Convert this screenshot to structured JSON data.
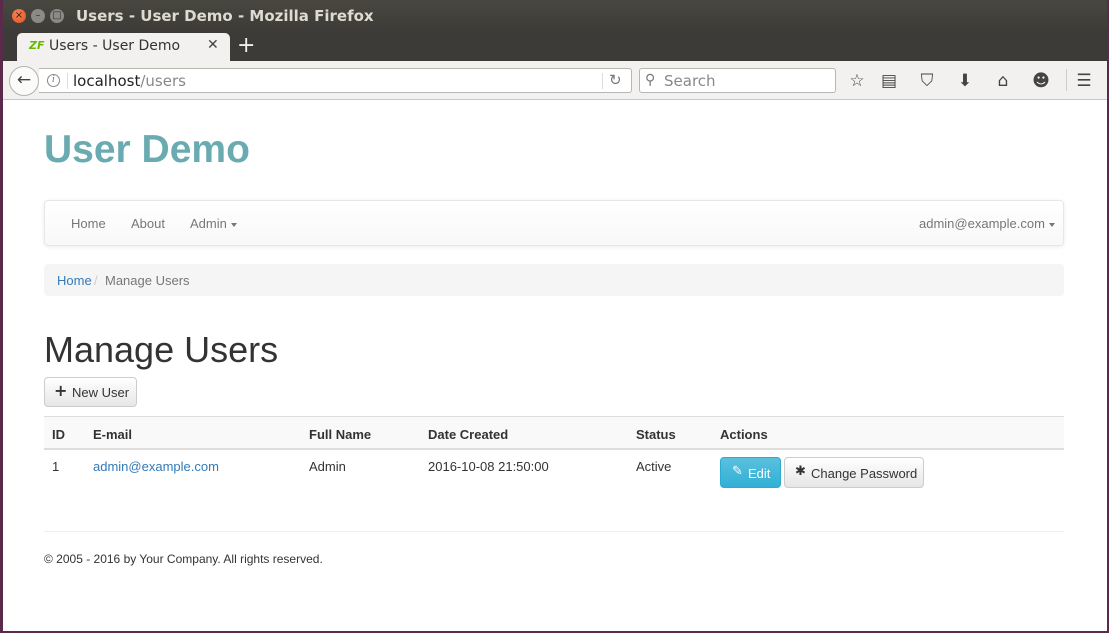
{
  "window": {
    "title": "Users - User Demo - Mozilla Firefox",
    "close_glyph": "×",
    "minimize_glyph": "–",
    "maximize_glyph": "□"
  },
  "tab": {
    "favicon_text": "ZF",
    "title": "Users - User Demo",
    "close_glyph": "✕",
    "new_tab_glyph": "+"
  },
  "toolbar": {
    "back_glyph": "←",
    "info_glyph": "i",
    "url_host": "localhost",
    "url_path": "/users",
    "reload_glyph": "↻",
    "search_glyph": "⚲",
    "search_placeholder": "Search",
    "icons": {
      "bookmark_star": "☆",
      "reading_list": "▤",
      "pocket": "⛉",
      "downloads": "⬇",
      "home": "⌂",
      "hello": "☻",
      "menu": "☰"
    }
  },
  "page": {
    "brand": "User Demo",
    "nav": {
      "items": [
        "Home",
        "About",
        "Admin"
      ],
      "user": "admin@example.com"
    },
    "breadcrumb": {
      "home": "Home",
      "separator": "/",
      "current": "Manage Users"
    },
    "title": "Manage Users",
    "new_user_button": {
      "icon": "+",
      "label": "New User"
    },
    "table": {
      "headers": [
        "ID",
        "E-mail",
        "Full Name",
        "Date Created",
        "Status",
        "Actions"
      ],
      "rows": [
        {
          "id": "1",
          "email": "admin@example.com",
          "full_name": "Admin",
          "date_created": "2016-10-08 21:50:00",
          "status": "Active"
        }
      ],
      "edit_button": {
        "icon": "✎",
        "label": "Edit"
      },
      "change_password_button": {
        "icon": "✱",
        "label": "Change Password"
      }
    },
    "footer": "© 2005 - 2016 by Your Company. All rights reserved."
  },
  "colors": {
    "brand": "#6aabb1",
    "link": "#337ab7",
    "info_button": "#5bc0de"
  }
}
